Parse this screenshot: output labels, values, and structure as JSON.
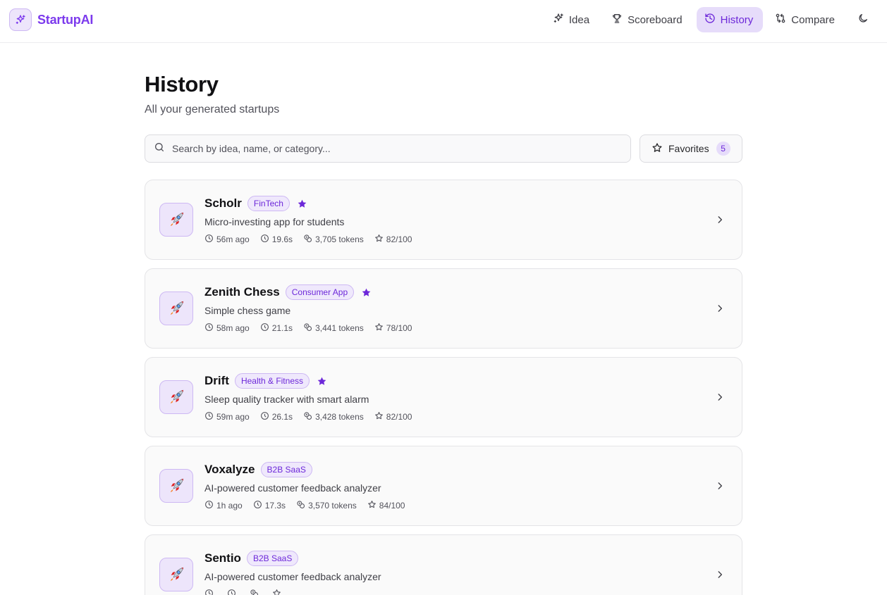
{
  "app": {
    "name": "StartupAI"
  },
  "nav": {
    "items": [
      {
        "label": "Idea",
        "icon": "sparkles-icon"
      },
      {
        "label": "Scoreboard",
        "icon": "trophy-icon"
      },
      {
        "label": "History",
        "icon": "history-icon",
        "active": true
      },
      {
        "label": "Compare",
        "icon": "compare-icon"
      }
    ],
    "theme_icon": "moon-icon"
  },
  "page": {
    "title": "History",
    "subtitle": "All your generated startups"
  },
  "search": {
    "placeholder": "Search by idea, name, or category..."
  },
  "favorites": {
    "label": "Favorites",
    "count": "5"
  },
  "colors": {
    "accent": "#7c3aed",
    "accent_bg": "#e6dcfa",
    "star": "#6d28d9"
  },
  "startups": [
    {
      "name": "Scholr",
      "category": "FinTech",
      "favorite": true,
      "description": "Micro-investing app for students",
      "ago": "56m ago",
      "duration": "19.6s",
      "tokens": "3,705 tokens",
      "score": "82/100"
    },
    {
      "name": "Zenith Chess",
      "category": "Consumer App",
      "favorite": true,
      "description": "Simple chess game",
      "ago": "58m ago",
      "duration": "21.1s",
      "tokens": "3,441 tokens",
      "score": "78/100"
    },
    {
      "name": "Drift",
      "category": "Health & Fitness",
      "favorite": true,
      "description": "Sleep quality tracker with smart alarm",
      "ago": "59m ago",
      "duration": "26.1s",
      "tokens": "3,428 tokens",
      "score": "82/100"
    },
    {
      "name": "Voxalyze",
      "category": "B2B SaaS",
      "favorite": false,
      "description": "AI-powered customer feedback analyzer",
      "ago": "1h ago",
      "duration": "17.3s",
      "tokens": "3,570 tokens",
      "score": "84/100"
    },
    {
      "name": "Sentio",
      "category": "B2B SaaS",
      "favorite": false,
      "description": "AI-powered customer feedback analyzer",
      "ago": "",
      "duration": "",
      "tokens": "",
      "score": ""
    }
  ]
}
